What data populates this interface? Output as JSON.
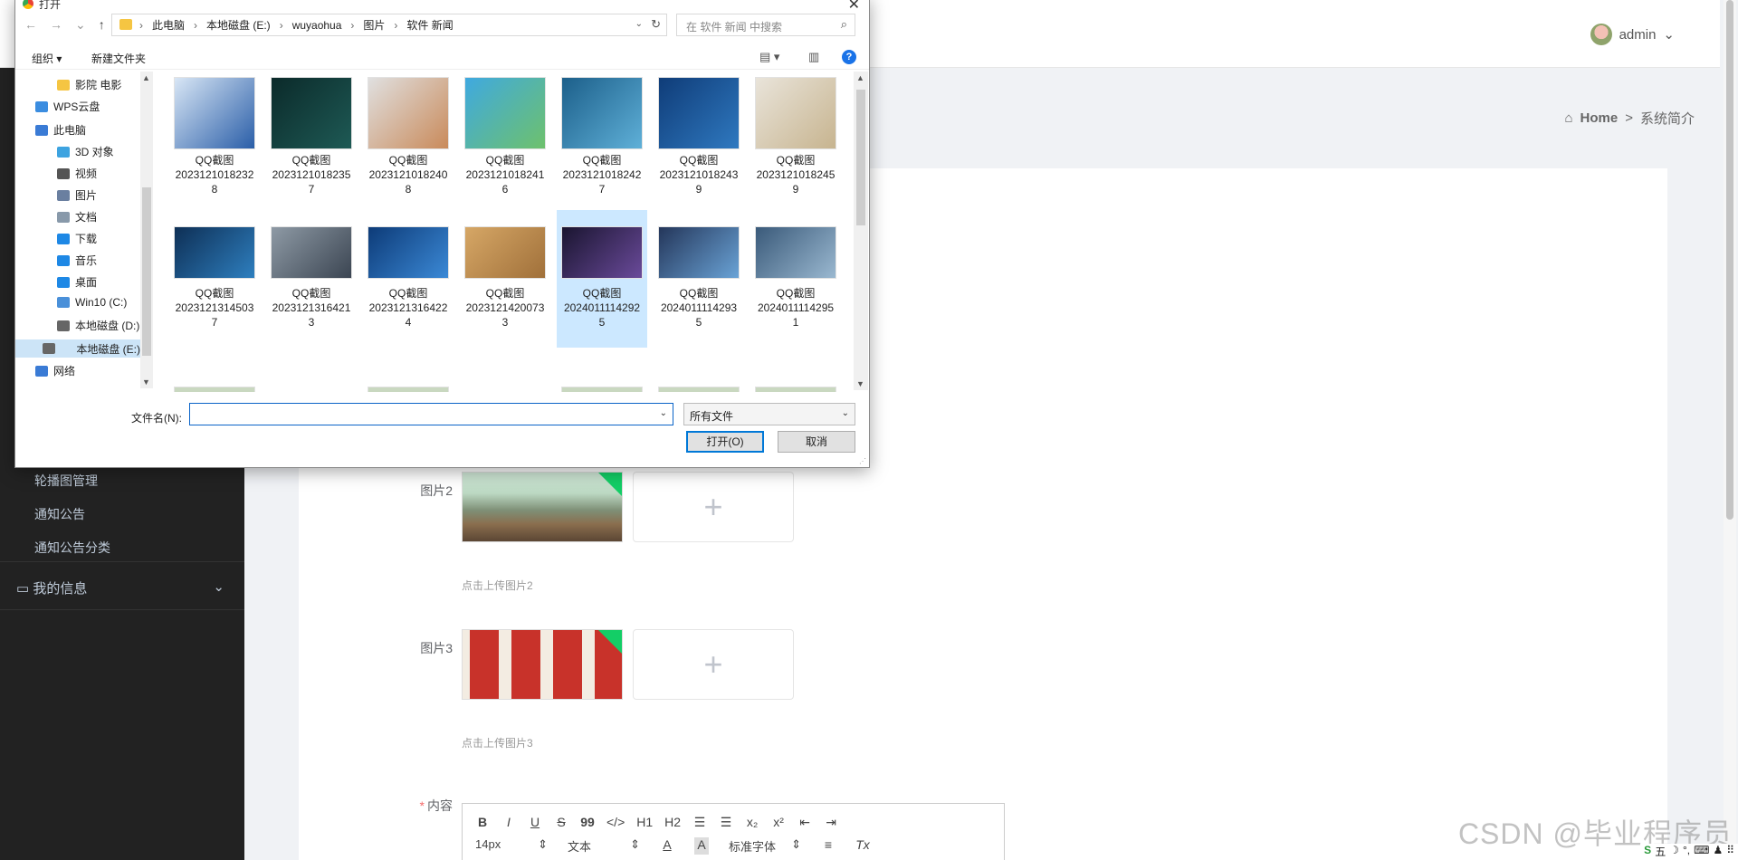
{
  "app": {
    "user_name": "admin",
    "user_caret": "⌄",
    "breadcrumb": {
      "home": "Home",
      "sep": ">",
      "current": "系统简介"
    },
    "sidebar": {
      "items": [
        {
          "label": "轮播图管理"
        },
        {
          "label": "通知公告"
        },
        {
          "label": "通知公告分类"
        }
      ],
      "group": {
        "label": "我的信息",
        "icon": "▭",
        "caret": "⌄"
      }
    },
    "form": {
      "image2_label": "图片2",
      "image2_hint": "点击上传图片2",
      "image3_label": "图片3",
      "image3_hint": "点击上传图片3",
      "content_required": "*",
      "content_label": "内容",
      "upload_plus": "+"
    },
    "editor": {
      "row1": [
        "B",
        "I",
        "U",
        "S",
        "99",
        "</>",
        "H1",
        "H2",
        "☰",
        "☰",
        "x₂",
        "x²",
        "⇤",
        "⇥"
      ],
      "font_size": "14px",
      "block_type": "文本",
      "font_family": "标准字体",
      "color_btn": "A",
      "bg_btn": "A",
      "align_btn": "≡",
      "clear_btn": "Tx",
      "spinner": "⇕"
    },
    "watermark": "CSDN @毕业程序员",
    "tray": [
      "S",
      "五",
      "☽",
      "°,",
      "⌨",
      "♟",
      "⠿"
    ]
  },
  "dialog": {
    "title": "打开",
    "close": "✕",
    "nav": {
      "back": "←",
      "forward": "→",
      "recent": "⌄",
      "up": "↑"
    },
    "address": {
      "segments": [
        "此电脑",
        "本地磁盘 (E:)",
        "wuyaohua",
        "图片",
        "软件 新闻"
      ],
      "sep": "›",
      "dropdown": "⌄",
      "refresh": "↻"
    },
    "search": {
      "placeholder": "在 软件 新闻 中搜索",
      "icon": "⌕"
    },
    "toolbar": {
      "organize": "组织 ▾",
      "new_folder": "新建文件夹",
      "view": "▤ ▾",
      "pane": "▥",
      "help": "?"
    },
    "nav_pane": [
      {
        "label": "影院 电影",
        "icon_color": "#f5c542"
      },
      {
        "label": "WPS云盘",
        "icon_color": "#3b8de0"
      },
      {
        "label": "此电脑",
        "icon_color": "#3a7bd5"
      },
      {
        "label": "3D 对象",
        "icon_color": "#3da3e0"
      },
      {
        "label": "视频",
        "icon_color": "#555555"
      },
      {
        "label": "图片",
        "icon_color": "#6a7fa0"
      },
      {
        "label": "文档",
        "icon_color": "#8899aa"
      },
      {
        "label": "下载",
        "icon_color": "#1e88e5"
      },
      {
        "label": "音乐",
        "icon_color": "#1e88e5"
      },
      {
        "label": "桌面",
        "icon_color": "#1e88e5"
      },
      {
        "label": "Win10 (C:)",
        "icon_color": "#4a90d9"
      },
      {
        "label": "本地磁盘 (D:)",
        "icon_color": "#666666"
      },
      {
        "label": "本地磁盘 (E:)",
        "icon_color": "#666666"
      },
      {
        "label": "网络",
        "icon_color": "#3a7bd5"
      }
    ],
    "files": [
      {
        "name": "QQ截图",
        "id_a": "2023121018232",
        "id_b": "8"
      },
      {
        "name": "QQ截图",
        "id_a": "2023121018235",
        "id_b": "7"
      },
      {
        "name": "QQ截图",
        "id_a": "2023121018240",
        "id_b": "8"
      },
      {
        "name": "QQ截图",
        "id_a": "2023121018241",
        "id_b": "6"
      },
      {
        "name": "QQ截图",
        "id_a": "2023121018242",
        "id_b": "7"
      },
      {
        "name": "QQ截图",
        "id_a": "2023121018243",
        "id_b": "9"
      },
      {
        "name": "QQ截图",
        "id_a": "2023121018245",
        "id_b": "9"
      },
      {
        "name": "QQ截图",
        "id_a": "2023121314503",
        "id_b": "7"
      },
      {
        "name": "QQ截图",
        "id_a": "2023121316421",
        "id_b": "3"
      },
      {
        "name": "QQ截图",
        "id_a": "2023121316422",
        "id_b": "4"
      },
      {
        "name": "QQ截图",
        "id_a": "2023121420073",
        "id_b": "3"
      },
      {
        "name": "QQ截图",
        "id_a": "2024011114292",
        "id_b": "5"
      },
      {
        "name": "QQ截图",
        "id_a": "2024011114293",
        "id_b": "5"
      },
      {
        "name": "QQ截图",
        "id_a": "2024011114295",
        "id_b": "1"
      }
    ],
    "thumb_colors": [
      [
        "#d8e6f5",
        "#2a5ea8"
      ],
      [
        "#0b2a2a",
        "#1e5a55"
      ],
      [
        "#e0e0e0",
        "#c98a5a"
      ],
      [
        "#3fa9e0",
        "#6ec16c"
      ],
      [
        "#1c5f8a",
        "#5fb0d8"
      ],
      [
        "#0f3c78",
        "#2f79c0"
      ],
      [
        "#e9e4da",
        "#c7b48f"
      ],
      [
        "#0e2f55",
        "#2e7fbf"
      ],
      [
        "#8e9aa5",
        "#3b4552"
      ],
      [
        "#0d3b78",
        "#3b89d6"
      ],
      [
        "#d6a766",
        "#a0703a"
      ],
      [
        "#1a1530",
        "#6a4a9a"
      ],
      [
        "#24365a",
        "#6aa3d6"
      ],
      [
        "#3a5a7a",
        "#9ab8d0"
      ]
    ],
    "filename_label": "文件名(N):",
    "filename_value": "",
    "filename_dropdown": "⌄",
    "filetype": "所有文件",
    "filetype_dropdown": "⌄",
    "open_label": "打开(O)",
    "cancel_label": "取消",
    "scroll_up": "▲",
    "scroll_down": "▼",
    "grip": "⋰"
  }
}
